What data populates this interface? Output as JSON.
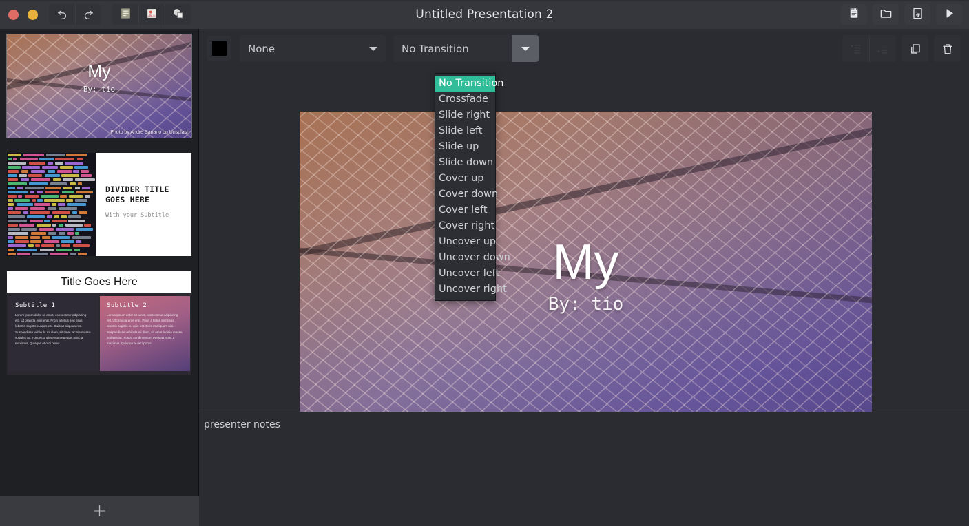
{
  "window": {
    "title": "Untitled Presentation 2",
    "traffic_lights": [
      "close-red",
      "minimize-yellow"
    ]
  },
  "titlebar": {
    "left_buttons": [
      {
        "name": "undo",
        "glyph": "undo-icon"
      },
      {
        "name": "redo",
        "glyph": "redo-icon"
      }
    ],
    "insert_buttons": [
      {
        "name": "insert-text-box",
        "glyph": "text-box-icon"
      },
      {
        "name": "insert-image",
        "glyph": "image-icon"
      },
      {
        "name": "insert-shape",
        "glyph": "shape-icon"
      }
    ],
    "right_buttons": [
      {
        "name": "notes",
        "glyph": "notepad-icon"
      },
      {
        "name": "open-folder",
        "glyph": "folder-icon"
      },
      {
        "name": "export",
        "glyph": "export-icon"
      },
      {
        "name": "present",
        "glyph": "play-icon"
      }
    ]
  },
  "toolbar": {
    "color_swatch_value": "#000000",
    "layout_select": {
      "value": "None",
      "placeholder": "None"
    },
    "transition_select": {
      "value": "No Transition"
    },
    "right_buttons": [
      {
        "name": "move-slide-up",
        "enabled": false
      },
      {
        "name": "move-slide-down",
        "enabled": false
      },
      {
        "name": "duplicate-slide",
        "enabled": true
      },
      {
        "name": "delete-slide",
        "enabled": true
      }
    ]
  },
  "transition_menu": {
    "open": true,
    "selected": "No Transition",
    "items": [
      "No Transition",
      "Crossfade",
      "Slide right",
      "Slide left",
      "Slide up",
      "Slide down",
      "Cover up",
      "Cover down",
      "Cover left",
      "Cover right",
      "Uncover up",
      "Uncover down",
      "Uncover left",
      "Uncover right"
    ]
  },
  "sidebar": {
    "add_slide_label": "+",
    "slides": [
      {
        "index": 1,
        "selected": true,
        "type": "title-photo",
        "title": "My",
        "subtitle": "By: tio",
        "credit": "Photo by André Sanano on Unsplash"
      },
      {
        "index": 2,
        "selected": false,
        "type": "divider",
        "title": "DIVIDER TITLE GOES HERE",
        "subtitle": "With your Subtitle"
      },
      {
        "index": 3,
        "selected": false,
        "type": "two-column",
        "title": "Title Goes Here",
        "columns": [
          {
            "heading": "Subtitle 1",
            "body": "Lorem ipsum dolor sit amet, consectetur adipiscing elit. Ut gravida eros erat. Proin a tellus sed risus lobortis sagittis eu quis est. Duis ut aliquam nisi. Suspendisse vehicula mi diam, sit amet lacinia massa sodales ac. Fusce condimentum egestas nunc a maximus. Quisque et orci purus"
          },
          {
            "heading": "Subtitle 2",
            "body": "Lorem ipsum dolor sit amet, consectetur adipiscing elit. Ut gravida eros erat. Proin a tellus sed risus lobortis sagittis eu quis est. Duis ut aliquam nisi. Suspendisse vehicula mi diam, sit amet lacinia massa sodales ac. Fusce condimentum egestas nunc a maximus. Quisque et orci purus"
          }
        ]
      }
    ]
  },
  "canvas": {
    "title": "My",
    "subtitle": "By: tio",
    "credit": "Photo by André Sanano on Unsplash"
  },
  "notes": {
    "text": "presenter notes",
    "placeholder": "presenter notes"
  },
  "colors": {
    "accent_highlight": "#31bd99",
    "titlebar_bg": "#36373d",
    "sidebar_bg": "#1f2024",
    "main_bg": "#2b2c31",
    "control_bg": "#2f3035",
    "traffic_red": "#e06c66",
    "traffic_yellow": "#e8b13c"
  }
}
